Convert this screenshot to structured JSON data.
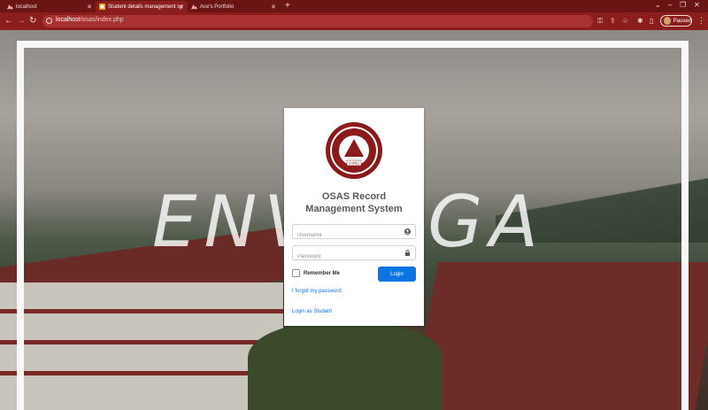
{
  "browser": {
    "tabs": [
      {
        "label": "localhost",
        "active": false
      },
      {
        "label": "Student details management sy",
        "active": true
      },
      {
        "label": "Ace's Portfolio",
        "active": false
      }
    ],
    "new_tab": "+",
    "url_host": "localhost",
    "url_path": "/osas/index.php",
    "profile_status": "Paused",
    "theme_color": "#8b1d1d"
  },
  "background": {
    "watermark_text": "ENVERGA"
  },
  "login": {
    "seal_year": "1992",
    "title_line1": "OSAS Record",
    "title_line2": "Management System",
    "username_placeholder": "Username",
    "password_placeholder": "Password",
    "remember_label": "Remember Me",
    "login_button": "Login",
    "forgot_link": "I forgot my password",
    "student_link": "Login as Student",
    "accent_color": "#0d74e3"
  }
}
